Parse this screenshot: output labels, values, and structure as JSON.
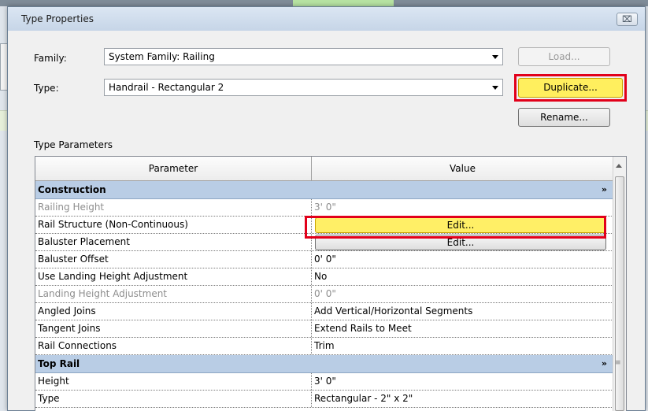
{
  "dialog": {
    "title": "Type Properties",
    "close_label": "⌧"
  },
  "family": {
    "label": "Family:",
    "value": "System Family: Railing"
  },
  "type": {
    "label": "Type:",
    "value": "Handrail - Rectangular 2"
  },
  "buttons": {
    "load": "Load...",
    "duplicate": "Duplicate...",
    "rename": "Rename..."
  },
  "section_label": "Type Parameters",
  "grid": {
    "col_parameter": "Parameter",
    "col_value": "Value",
    "groups": [
      {
        "name": "Construction",
        "rows": [
          {
            "param": "Railing Height",
            "value": "3'  0\"",
            "dim": true
          },
          {
            "param": "Rail Structure (Non-Continuous)",
            "button": "Edit...",
            "highlight": true
          },
          {
            "param": "Baluster Placement",
            "button": "Edit..."
          },
          {
            "param": "Baluster Offset",
            "value": "0'  0\""
          },
          {
            "param": "Use Landing Height Adjustment",
            "value": "No"
          },
          {
            "param": "Landing Height Adjustment",
            "value": "0'  0\"",
            "dim": true
          },
          {
            "param": "Angled Joins",
            "value": "Add Vertical/Horizontal Segments"
          },
          {
            "param": "Tangent Joins",
            "value": "Extend Rails to Meet"
          },
          {
            "param": "Rail Connections",
            "value": "Trim"
          }
        ]
      },
      {
        "name": "Top Rail",
        "rows": [
          {
            "param": "Height",
            "value": "3'  0\""
          },
          {
            "param": "Type",
            "value": "Rectangular - 2\" x 2\""
          }
        ]
      }
    ],
    "collapse_glyph": "»"
  },
  "colors": {
    "highlight_border": "#e2001a",
    "highlight_fill": "#ffef5e",
    "group_header": "#b9cde5"
  }
}
